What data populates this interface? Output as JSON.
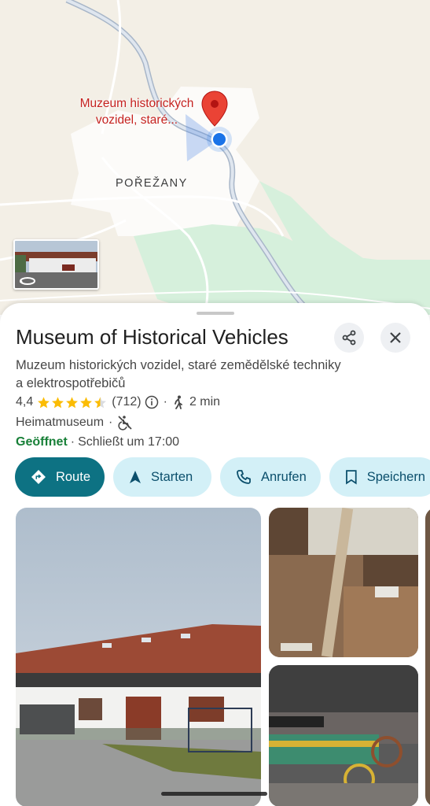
{
  "map": {
    "pin_label": "Muzeum historických vozidel, staré...",
    "town_label": "POŘEŽANY",
    "pin_color": "#ea4335",
    "location_dot_color": "#1a73e8"
  },
  "place": {
    "title": "Museum of Historical Vehicles",
    "subtitle": "Muzeum historických vozidel, staré zemědělské techniky a elektrospotřebičů",
    "rating": "4,4",
    "rating_value": 4.4,
    "reviews": "(712)",
    "walk_time": "2 min",
    "category": "Heimatmuseum",
    "separator": "·",
    "status": "Geöffnet",
    "closes": "Schließt um 17:00"
  },
  "actions": {
    "route": "Route",
    "start": "Starten",
    "call": "Anrufen",
    "save": "Speichern"
  },
  "icons": [
    "share-icon",
    "close-icon",
    "star-icon",
    "info-icon",
    "walk-icon",
    "no-wheelchair-icon",
    "directions-icon",
    "navigation-arrow-icon",
    "phone-icon",
    "bookmark-icon",
    "rotate-360-icon"
  ],
  "colors": {
    "accent": "#0d7283",
    "chip_bg": "#d3f0f7",
    "open_green": "#188038",
    "star": "#fbbc04"
  }
}
